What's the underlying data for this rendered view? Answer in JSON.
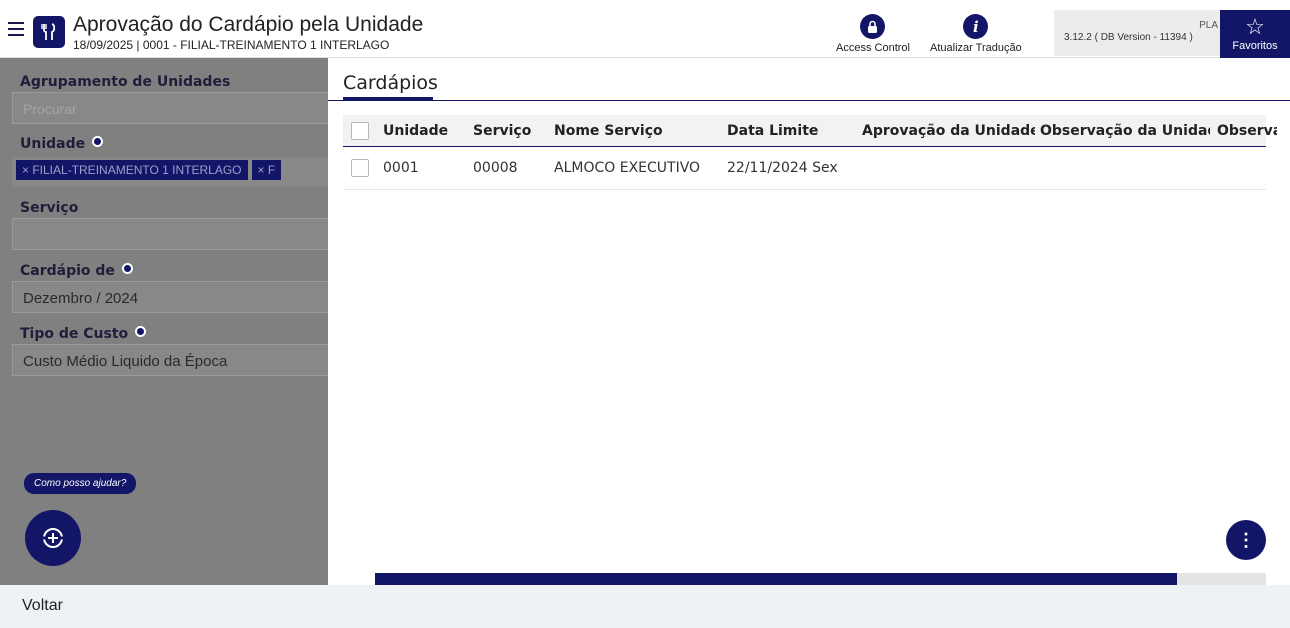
{
  "header": {
    "title": "Aprovação do Cardápio pela Unidade",
    "subtitle": "18/09/2025 | 0001 - FILIAL-TREINAMENTO 1 INTERLAGO",
    "logo_icon": "fork-knife-icon",
    "access_control_label": "Access Control",
    "access_control_icon": "lock-icon",
    "atualizar_label": "Atualizar Tradução",
    "atualizar_icon": "info-icon",
    "version_user": "PLA",
    "version_text": "3.12.2 ( DB Version - 11394 )",
    "favoritos_label": "Favoritos",
    "favoritos_icon": "star-icon"
  },
  "sidebar": {
    "agrupamento_label": "Agrupamento de Unidades",
    "agrupamento_placeholder": "Procurar",
    "unidade_label": "Unidade",
    "unidade_chips": [
      "× FILIAL-TREINAMENTO 1 INTERLAGO",
      "× F"
    ],
    "servico_label": "Serviço",
    "servico_value": "",
    "cardapio_label": "Cardápio de",
    "cardapio_value": "Dezembro / 2024",
    "tipo_custo_label": "Tipo de Custo",
    "tipo_custo_value": "Custo Médio Liquido da Época",
    "help_text": "Como posso ajudar?",
    "help_icon": "assistant-icon"
  },
  "main": {
    "tab_title": "Cardápios",
    "columns": [
      "Unidade",
      "Serviço",
      "Nome Serviço",
      "Data Limite",
      "Aprovação da Unidade",
      "Observação da Unidad",
      "Observa"
    ],
    "rows": [
      [
        "0001",
        "00008",
        "ALMOCO EXECUTIVO",
        "22/11/2024 Sex",
        "",
        "",
        ""
      ]
    ],
    "more_icon": "more-vertical-icon",
    "scroll_fraction": 0.9
  },
  "footer": {
    "back_label": "Voltar"
  },
  "colors": {
    "primary": "#131567",
    "overlay": "#808080",
    "footer_bg": "#eef2f5"
  }
}
